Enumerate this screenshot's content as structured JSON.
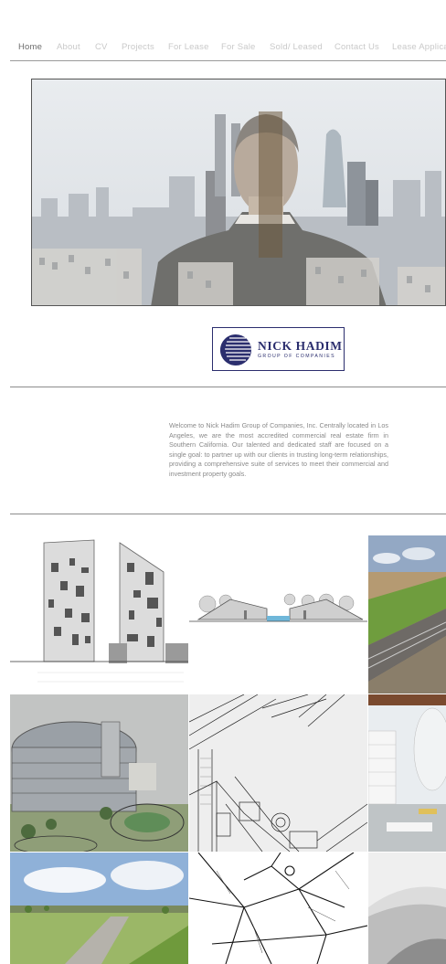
{
  "nav": {
    "items": [
      {
        "label": "Home",
        "active": true
      },
      {
        "label": "About"
      },
      {
        "label": "CV"
      },
      {
        "label": "Projects"
      },
      {
        "label": "For Lease"
      },
      {
        "label": "For Sale"
      },
      {
        "label": "Sold/ Leased"
      },
      {
        "label": "Contact Us"
      },
      {
        "label": "Lease Applicat"
      }
    ]
  },
  "logo": {
    "name": "NICK HADIM",
    "subtitle": "GROUP OF COMPANIES",
    "color": "#2b2e6e"
  },
  "welcome": {
    "text": "Welcome to Nick Hadim Group of Companies, Inc. Centrally located in Los Angeles, we are the most accredited commercial real estate firm in Southern California. Our talented and dedicated staff are focused on a single goal: to partner up with our clients in trusting long-term relationships, providing a comprehensive suite of services to meet their commercial and investment property goals."
  },
  "gallery": {
    "tiles": [
      {
        "icon": "building-elevation-drawing"
      },
      {
        "icon": "section-drawing"
      },
      {
        "icon": "rail-landscape-render"
      },
      {
        "icon": "round-building-render"
      },
      {
        "icon": "site-plan-sketch"
      },
      {
        "icon": "white-model-render"
      },
      {
        "icon": "park-landscape-render"
      },
      {
        "icon": "street-map-drawing"
      },
      {
        "icon": "white-architecture-photo"
      }
    ]
  }
}
